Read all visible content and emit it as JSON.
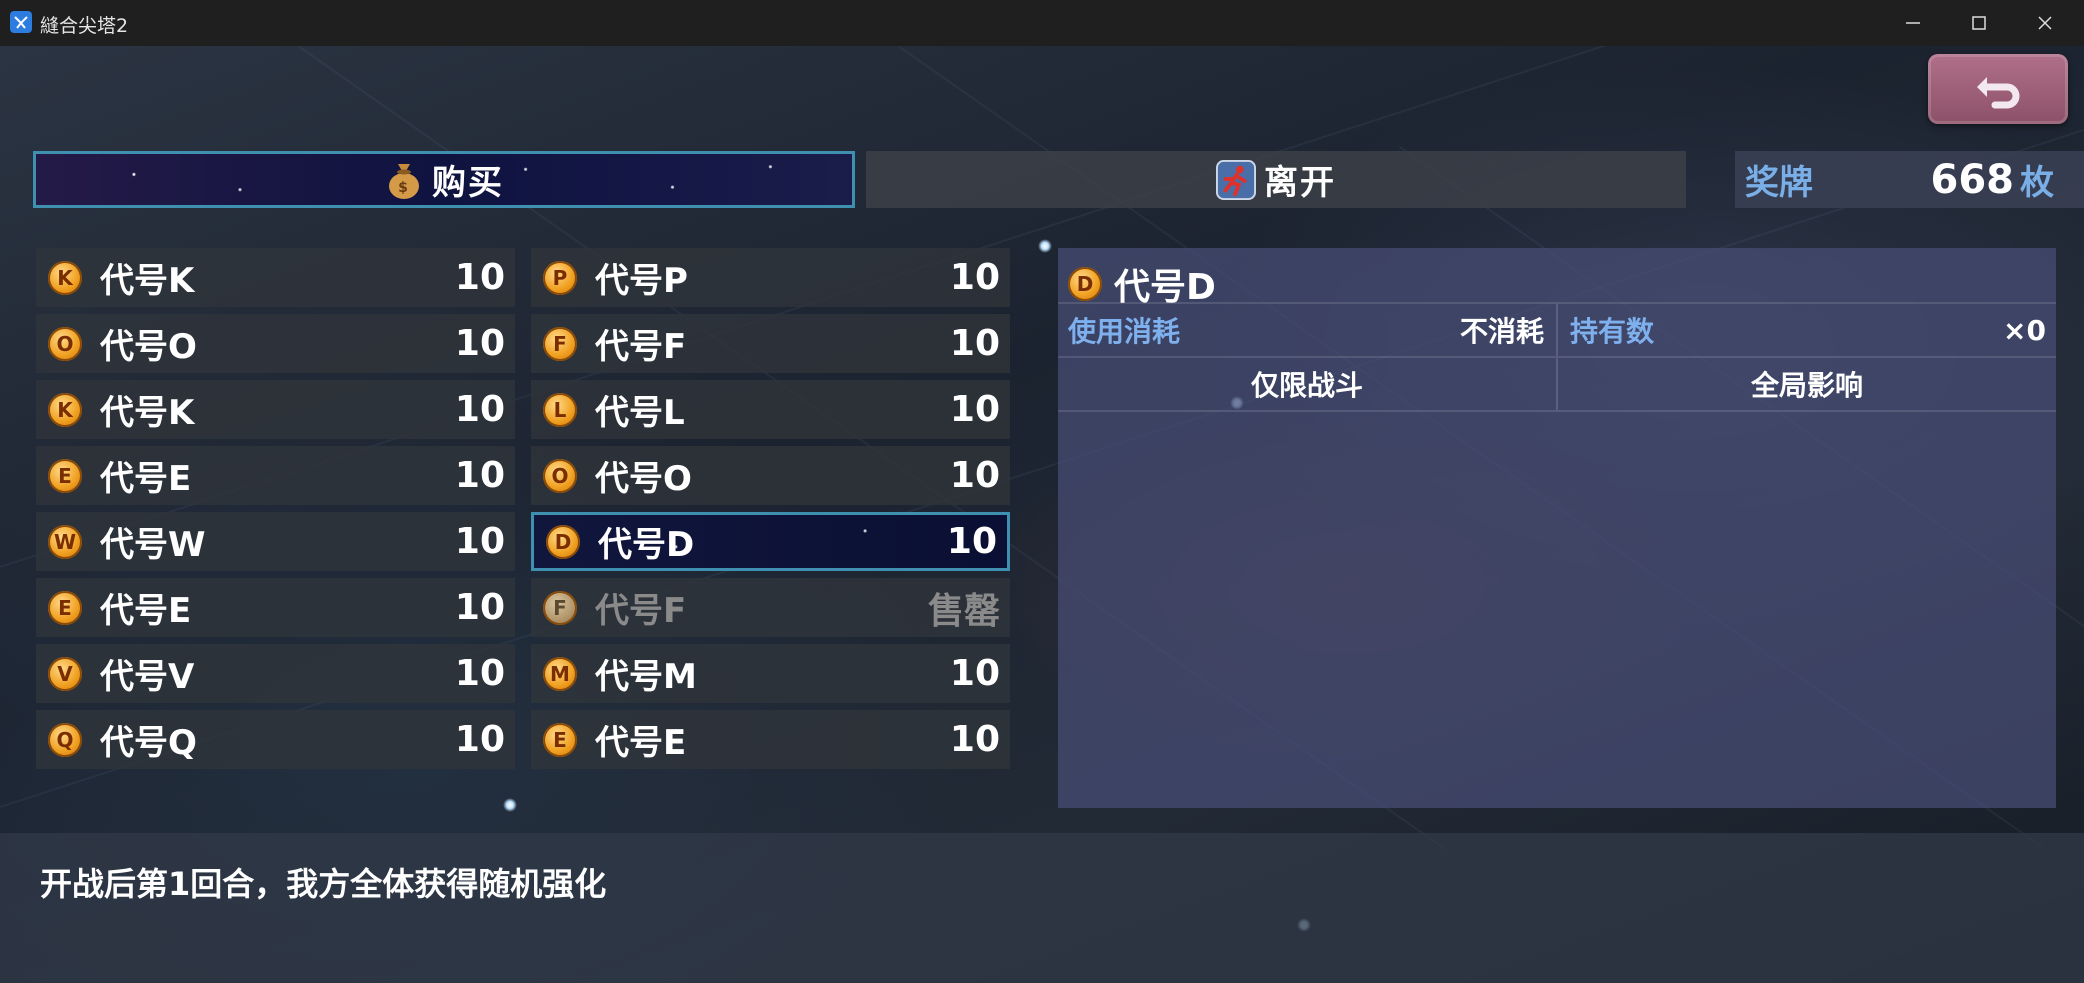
{
  "window": {
    "title": "縫合尖塔2",
    "controls": [
      "minimize",
      "maximize",
      "close"
    ]
  },
  "commands": {
    "buy": {
      "label": "购买",
      "icon": "money-bag-icon",
      "selected": true
    },
    "leave": {
      "label": "离开",
      "icon": "running-man-icon"
    }
  },
  "currency": {
    "label": "奖牌",
    "value": "668",
    "unit": "枚"
  },
  "items": [
    {
      "coin": "K",
      "name": "代号K",
      "price": "10"
    },
    {
      "coin": "P",
      "name": "代号P",
      "price": "10"
    },
    {
      "coin": "O",
      "name": "代号O",
      "price": "10"
    },
    {
      "coin": "F",
      "name": "代号F",
      "price": "10"
    },
    {
      "coin": "K",
      "name": "代号K",
      "price": "10"
    },
    {
      "coin": "L",
      "name": "代号L",
      "price": "10"
    },
    {
      "coin": "E",
      "name": "代号E",
      "price": "10"
    },
    {
      "coin": "O",
      "name": "代号O",
      "price": "10"
    },
    {
      "coin": "W",
      "name": "代号W",
      "price": "10"
    },
    {
      "coin": "D",
      "name": "代号D",
      "price": "10",
      "selected": true
    },
    {
      "coin": "E",
      "name": "代号E",
      "price": "10"
    },
    {
      "coin": "F",
      "name": "代号F",
      "price": "售罄",
      "sold_out": true
    },
    {
      "coin": "V",
      "name": "代号V",
      "price": "10"
    },
    {
      "coin": "M",
      "name": "代号M",
      "price": "10"
    },
    {
      "coin": "Q",
      "name": "代号Q",
      "price": "10"
    },
    {
      "coin": "E",
      "name": "代号E",
      "price": "10"
    }
  ],
  "detail": {
    "coin": "D",
    "name": "代号D",
    "use_cost_label": "使用消耗",
    "use_cost_value": "不消耗",
    "owned_label": "持有数",
    "owned_value": "×0",
    "scope": "仅限战斗",
    "effect_range": "全局影响"
  },
  "help": {
    "text": "开战后第1回合，我方全体获得随机强化"
  },
  "colors": {
    "accent_border": "#3f8fb0",
    "label_blue": "#7fb0ee",
    "coin_gold": "#f0a020",
    "back_button": "#9c5e77"
  }
}
